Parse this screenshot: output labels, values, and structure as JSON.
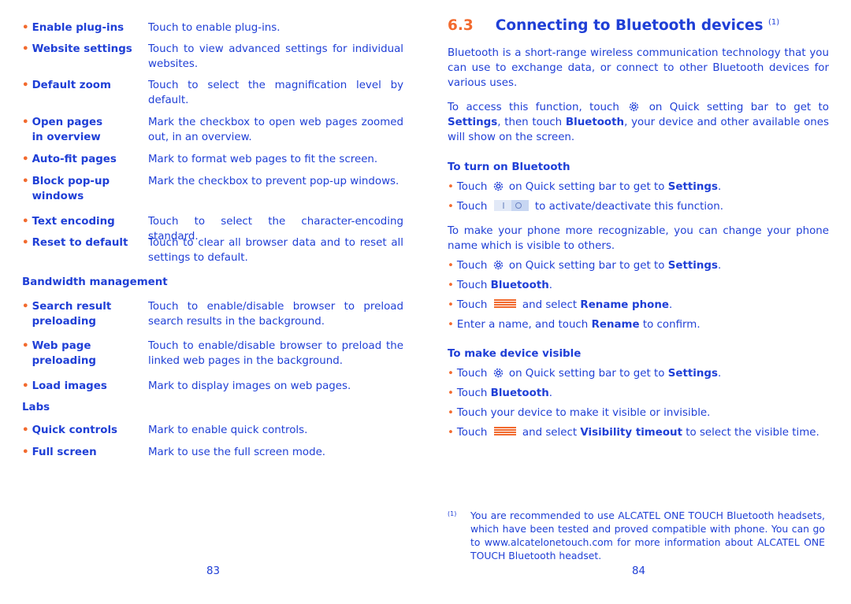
{
  "colors": {
    "text": "#1f3fd6",
    "accent": "#f26a2e"
  },
  "left_page": {
    "rows": [
      {
        "term": "Enable plug-ins",
        "desc": "Touch to enable plug-ins."
      },
      {
        "term": "Website settings",
        "desc": "Touch to view advanced settings for individual websites."
      },
      {
        "term": "Default zoom",
        "desc": "Touch to select the magnification level by default."
      },
      {
        "term": "Open pages in overview",
        "desc": "Mark the checkbox to open web pages zoomed out, in an overview."
      },
      {
        "term": "Auto-fit pages",
        "desc": "Mark to format web pages to fit the screen."
      },
      {
        "term": "Block pop-up windows",
        "desc": "Mark the checkbox to prevent pop-up windows."
      },
      {
        "term": "Text encoding",
        "desc": "Touch to select the character-encoding standard."
      },
      {
        "term": "Reset to default",
        "desc": "Touch to clear all browser data and to reset all settings to default."
      }
    ],
    "bandwidth_heading": "Bandwidth management",
    "bandwidth_rows": [
      {
        "term": "Search result preloading",
        "desc": "Touch to enable/disable browser to preload search results in the background."
      },
      {
        "term": "Web page preloading",
        "desc": "Touch to enable/disable browser to preload the linked web pages in the background."
      },
      {
        "term": "Load images",
        "desc": "Mark to display images on web pages."
      }
    ],
    "labs_heading": "Labs",
    "labs_rows": [
      {
        "term": "Quick controls",
        "desc": "Mark to enable quick controls."
      },
      {
        "term": "Full screen",
        "desc": "Mark to use the full screen mode."
      }
    ],
    "page_number": "83"
  },
  "right_page": {
    "section_number": "6.3",
    "section_title": "Connecting to Bluetooth devices",
    "section_footnote_ref": "(1)",
    "intro": "Bluetooth is a short-range wireless communication technology that you can use to exchange data, or connect to other Bluetooth devices for various uses.",
    "access": {
      "p1": "To access this function, touch",
      "p2": "on Quick setting bar to get to",
      "b1": "Settings",
      "p3": ", then touch",
      "b2": "Bluetooth",
      "p4": ", your device and other available ones will show on the screen."
    },
    "turn_on": {
      "heading": "To turn on Bluetooth",
      "b1_pre": "Touch",
      "b1_mid": "on Quick setting bar to get to",
      "b1_bold": "Settings",
      "b2_pre": "Touch",
      "b2_post": "to activate/deactivate this function."
    },
    "rename_intro": "To make your phone more recognizable, you can change your phone name which is visible to others.",
    "rename": {
      "b1_pre": "Touch",
      "b1_mid": "on Quick setting bar to get to",
      "b1_bold": "Settings",
      "b2_pre": "Touch",
      "b2_bold": "Bluetooth",
      "b3_pre": "Touch",
      "b3_mid": "and select",
      "b3_bold": "Rename phone",
      "b4_pre": "Enter a name, and touch",
      "b4_bold": "Rename",
      "b4_post": "to confirm."
    },
    "visible": {
      "heading": "To make device visible",
      "b1_pre": "Touch",
      "b1_mid": "on Quick setting bar to get to",
      "b1_bold": "Settings",
      "b2_pre": "Touch",
      "b2_bold": "Bluetooth",
      "b3": "Touch your device to make it visible or invisible.",
      "b4_pre": "Touch",
      "b4_mid": "and select",
      "b4_bold": "Visibility timeout",
      "b4_post": "to select the visible time."
    },
    "footnote": {
      "mark": "(1)",
      "text": "You are recommended to use ALCATEL ONE TOUCH Bluetooth headsets, which have been tested and proved compatible with phone. You can go to www.alcatelonetouch.com for more information about ALCATEL ONE TOUCH Bluetooth headset."
    },
    "page_number": "84"
  },
  "icons": {
    "settings": "gear-icon",
    "toggle": "bluetooth-toggle-icon",
    "menu": "menu-icon"
  }
}
